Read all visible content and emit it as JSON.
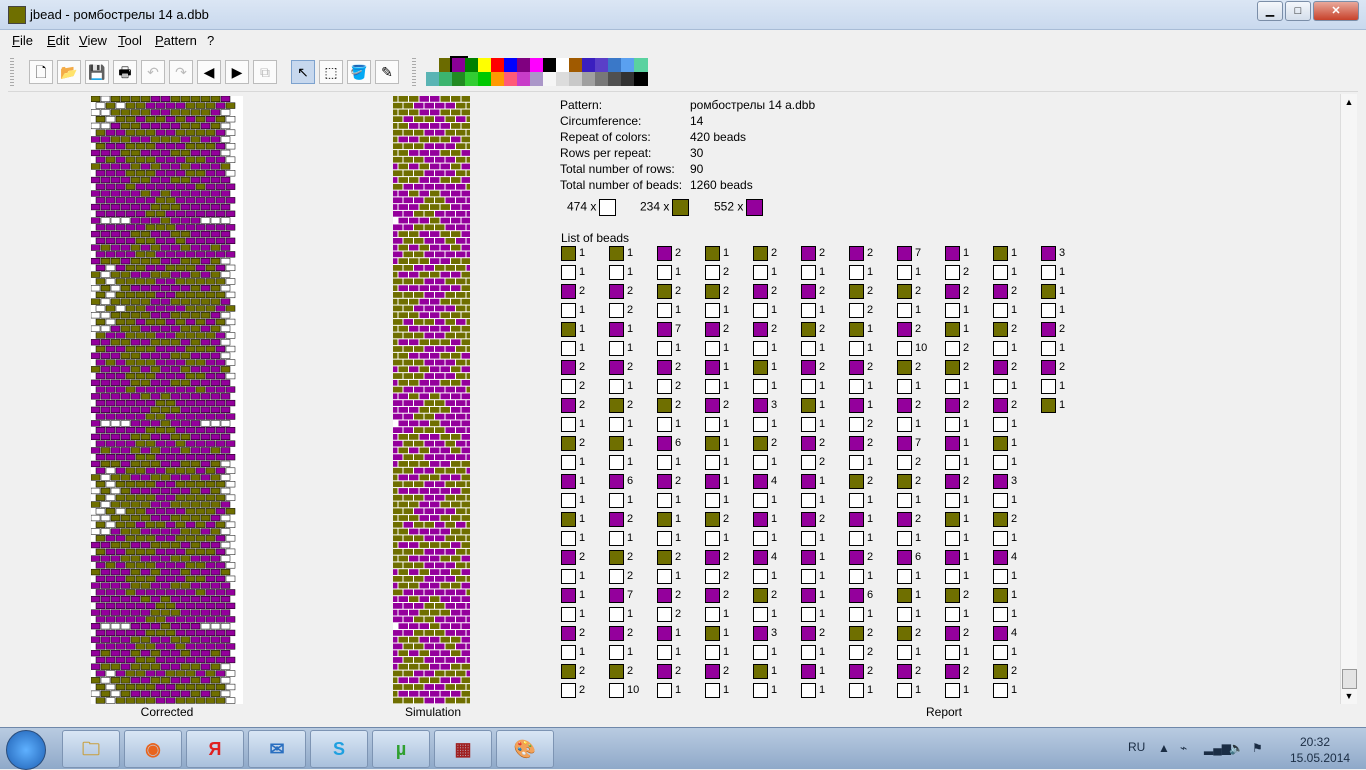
{
  "window": {
    "title": "jbead - ромбострелы 14 a.dbb"
  },
  "window_buttons": {
    "minimize": "▁",
    "maximize": "□",
    "close": "✕"
  },
  "menu": [
    "File",
    "Edit",
    "View",
    "Tool",
    "Pattern",
    "?"
  ],
  "toolbar": {
    "icons": [
      "new-file-icon",
      "open-folder-icon",
      "save-icon",
      "print-icon",
      "undo-icon",
      "redo-icon",
      "arrow-left-icon",
      "arrow-right-icon",
      "copy-icon",
      "pointer-icon",
      "select-rect-icon",
      "fill-bucket-icon",
      "eyedropper-icon"
    ],
    "glyphs": [
      "🗋",
      "📂",
      "💾",
      "🖶",
      "↶",
      "↷",
      "◀",
      "▶",
      "⧉",
      "↖",
      "⬚",
      "🪣",
      "✎"
    ]
  },
  "palette": {
    "row1": [
      "#f0f0f0",
      "#6b6b00",
      "#8a0096",
      "#008000",
      "#ffff00",
      "#ff0000",
      "#0000ff",
      "#800080",
      "#ff00ff",
      "#000000",
      "#ffffff",
      "#a05a00",
      "#3a1fbf",
      "#5a3fc8",
      "#3a78c8",
      "#5aa0f0",
      "#5ad2a0"
    ],
    "row2": [
      "#5ab4b4",
      "#3cb46e",
      "#228b22",
      "#32cd32",
      "#00c800",
      "#ff9a00",
      "#ff5a78",
      "#c83cc8",
      "#aa96c8",
      "#f5f5f5",
      "#dcdcdc",
      "#c8c8c8",
      "#a0a0a0",
      "#787878",
      "#505050",
      "#323232",
      "#000000"
    ],
    "selected_index": 2
  },
  "bead_colors": {
    "0": "#ffffff",
    "1": "#6f6f00",
    "2": "#94009c"
  },
  "panels": {
    "corrected": "Corrected",
    "simulation": "Simulation",
    "report": "Report"
  },
  "info": [
    {
      "key": "Pattern:",
      "value": "ромбострелы 14 a.dbb"
    },
    {
      "key": "Circumference:",
      "value": "14"
    },
    {
      "key": "Repeat of colors:",
      "value": "420 beads"
    },
    {
      "key": "Rows per repeat:",
      "value": "30"
    },
    {
      "key": "Total number of rows:",
      "value": "90"
    },
    {
      "key": "Total number of beads:",
      "value": "1260 beads"
    }
  ],
  "counts": [
    {
      "count": "474 x",
      "color": "#ffffff"
    },
    {
      "count": "234 x",
      "color": "#6f6f00"
    },
    {
      "count": "552 x",
      "color": "#94009c"
    }
  ],
  "list_title": "List of beads",
  "bead_list_columns": [
    [
      [
        1,
        1
      ],
      [
        0,
        1
      ],
      [
        2,
        2
      ],
      [
        0,
        1
      ],
      [
        1,
        1
      ],
      [
        0,
        1
      ],
      [
        2,
        2
      ],
      [
        0,
        2
      ],
      [
        2,
        2
      ],
      [
        0,
        1
      ],
      [
        1,
        2
      ],
      [
        0,
        1
      ],
      [
        2,
        1
      ],
      [
        0,
        1
      ],
      [
        1,
        1
      ],
      [
        0,
        1
      ],
      [
        2,
        2
      ],
      [
        0,
        1
      ],
      [
        2,
        1
      ],
      [
        0,
        1
      ],
      [
        2,
        2
      ],
      [
        0,
        1
      ],
      [
        1,
        2
      ],
      [
        0,
        2
      ]
    ],
    [
      [
        1,
        1
      ],
      [
        0,
        1
      ],
      [
        2,
        2
      ],
      [
        0,
        2
      ],
      [
        2,
        1
      ],
      [
        0,
        1
      ],
      [
        2,
        2
      ],
      [
        0,
        1
      ],
      [
        1,
        2
      ],
      [
        0,
        1
      ],
      [
        1,
        1
      ],
      [
        0,
        1
      ],
      [
        2,
        6
      ],
      [
        0,
        1
      ],
      [
        2,
        2
      ],
      [
        0,
        1
      ],
      [
        1,
        2
      ],
      [
        0,
        2
      ],
      [
        2,
        7
      ],
      [
        0,
        1
      ],
      [
        2,
        2
      ],
      [
        0,
        1
      ],
      [
        1,
        2
      ],
      [
        0,
        10
      ]
    ],
    [
      [
        2,
        2
      ],
      [
        0,
        1
      ],
      [
        1,
        2
      ],
      [
        0,
        1
      ],
      [
        2,
        7
      ],
      [
        0,
        1
      ],
      [
        2,
        2
      ],
      [
        0,
        2
      ],
      [
        1,
        2
      ],
      [
        0,
        1
      ],
      [
        2,
        6
      ],
      [
        0,
        1
      ],
      [
        2,
        2
      ],
      [
        0,
        1
      ],
      [
        1,
        1
      ],
      [
        0,
        1
      ],
      [
        1,
        2
      ],
      [
        0,
        1
      ],
      [
        2,
        2
      ],
      [
        0,
        2
      ],
      [
        2,
        1
      ],
      [
        0,
        1
      ],
      [
        2,
        2
      ],
      [
        0,
        1
      ]
    ],
    [
      [
        1,
        1
      ],
      [
        0,
        2
      ],
      [
        1,
        2
      ],
      [
        0,
        1
      ],
      [
        2,
        2
      ],
      [
        0,
        1
      ],
      [
        2,
        1
      ],
      [
        0,
        1
      ],
      [
        2,
        2
      ],
      [
        0,
        1
      ],
      [
        1,
        1
      ],
      [
        0,
        1
      ],
      [
        2,
        1
      ],
      [
        0,
        1
      ],
      [
        1,
        2
      ],
      [
        0,
        1
      ],
      [
        2,
        2
      ],
      [
        0,
        2
      ],
      [
        2,
        2
      ],
      [
        0,
        1
      ],
      [
        1,
        1
      ],
      [
        0,
        1
      ],
      [
        2,
        2
      ],
      [
        0,
        1
      ]
    ],
    [
      [
        1,
        2
      ],
      [
        0,
        1
      ],
      [
        2,
        2
      ],
      [
        0,
        1
      ],
      [
        2,
        2
      ],
      [
        0,
        1
      ],
      [
        1,
        1
      ],
      [
        0,
        1
      ],
      [
        2,
        3
      ],
      [
        0,
        1
      ],
      [
        1,
        2
      ],
      [
        0,
        1
      ],
      [
        2,
        4
      ],
      [
        0,
        1
      ],
      [
        2,
        1
      ],
      [
        0,
        1
      ],
      [
        2,
        4
      ],
      [
        0,
        1
      ],
      [
        1,
        2
      ],
      [
        0,
        1
      ],
      [
        2,
        3
      ],
      [
        0,
        1
      ],
      [
        1,
        1
      ],
      [
        0,
        1
      ]
    ],
    [
      [
        2,
        2
      ],
      [
        0,
        1
      ],
      [
        2,
        2
      ],
      [
        0,
        1
      ],
      [
        1,
        2
      ],
      [
        0,
        1
      ],
      [
        2,
        2
      ],
      [
        0,
        1
      ],
      [
        1,
        1
      ],
      [
        0,
        1
      ],
      [
        2,
        2
      ],
      [
        0,
        2
      ],
      [
        2,
        1
      ],
      [
        0,
        1
      ],
      [
        2,
        2
      ],
      [
        0,
        1
      ],
      [
        2,
        1
      ],
      [
        0,
        1
      ],
      [
        2,
        1
      ],
      [
        0,
        1
      ],
      [
        2,
        2
      ],
      [
        0,
        1
      ],
      [
        2,
        1
      ],
      [
        0,
        1
      ]
    ],
    [
      [
        2,
        2
      ],
      [
        0,
        1
      ],
      [
        1,
        2
      ],
      [
        0,
        2
      ],
      [
        1,
        1
      ],
      [
        0,
        1
      ],
      [
        2,
        2
      ],
      [
        0,
        1
      ],
      [
        2,
        1
      ],
      [
        0,
        2
      ],
      [
        2,
        2
      ],
      [
        0,
        1
      ],
      [
        1,
        2
      ],
      [
        0,
        1
      ],
      [
        2,
        1
      ],
      [
        0,
        1
      ],
      [
        2,
        2
      ],
      [
        0,
        1
      ],
      [
        2,
        6
      ],
      [
        0,
        1
      ],
      [
        1,
        2
      ],
      [
        0,
        2
      ],
      [
        2,
        2
      ],
      [
        0,
        1
      ]
    ],
    [
      [
        2,
        7
      ],
      [
        0,
        1
      ],
      [
        1,
        2
      ],
      [
        0,
        1
      ],
      [
        2,
        2
      ],
      [
        0,
        10
      ],
      [
        1,
        2
      ],
      [
        0,
        1
      ],
      [
        2,
        2
      ],
      [
        0,
        1
      ],
      [
        2,
        7
      ],
      [
        0,
        2
      ],
      [
        1,
        2
      ],
      [
        0,
        1
      ],
      [
        2,
        2
      ],
      [
        0,
        1
      ],
      [
        2,
        6
      ],
      [
        0,
        1
      ],
      [
        1,
        1
      ],
      [
        0,
        1
      ],
      [
        1,
        2
      ],
      [
        0,
        1
      ],
      [
        2,
        2
      ],
      [
        0,
        1
      ]
    ],
    [
      [
        2,
        1
      ],
      [
        0,
        2
      ],
      [
        2,
        2
      ],
      [
        0,
        1
      ],
      [
        1,
        1
      ],
      [
        0,
        2
      ],
      [
        1,
        2
      ],
      [
        0,
        1
      ],
      [
        2,
        2
      ],
      [
        0,
        1
      ],
      [
        2,
        1
      ],
      [
        0,
        1
      ],
      [
        2,
        2
      ],
      [
        0,
        1
      ],
      [
        1,
        1
      ],
      [
        0,
        1
      ],
      [
        2,
        1
      ],
      [
        0,
        1
      ],
      [
        1,
        2
      ],
      [
        0,
        1
      ],
      [
        2,
        2
      ],
      [
        0,
        1
      ],
      [
        2,
        2
      ],
      [
        0,
        1
      ]
    ],
    [
      [
        1,
        1
      ],
      [
        0,
        1
      ],
      [
        2,
        2
      ],
      [
        0,
        1
      ],
      [
        1,
        2
      ],
      [
        0,
        1
      ],
      [
        2,
        2
      ],
      [
        0,
        1
      ],
      [
        2,
        2
      ],
      [
        0,
        1
      ],
      [
        1,
        1
      ],
      [
        0,
        1
      ],
      [
        2,
        3
      ],
      [
        0,
        1
      ],
      [
        1,
        2
      ],
      [
        0,
        1
      ],
      [
        2,
        4
      ],
      [
        0,
        1
      ],
      [
        1,
        1
      ],
      [
        0,
        1
      ],
      [
        2,
        4
      ],
      [
        0,
        1
      ],
      [
        1,
        2
      ],
      [
        0,
        1
      ]
    ],
    [
      [
        2,
        3
      ],
      [
        0,
        1
      ],
      [
        1,
        1
      ],
      [
        0,
        1
      ],
      [
        2,
        2
      ],
      [
        0,
        1
      ],
      [
        2,
        2
      ],
      [
        0,
        1
      ],
      [
        1,
        1
      ]
    ]
  ],
  "corrected_rows": [
    "10111122111112",
    "01011222211121",
    "00111122111120",
    "10112112121210",
    "00211222211210",
    "12211122111120",
    "22112211121220",
    "12211122211120",
    "22211222112220",
    "21211122211220",
    "12221212212221",
    "22211122211220",
    "22221122112222",
    "22212222221222",
    "22222121222222",
    "22222211222222",
    "22222211122222",
    "22222112222222",
    "20002221222000",
    "22222111222222",
    "22221122112222",
    "22221122122222",
    "21221212212212",
    "22221122222222",
    "21121112211210",
    "20211221112120",
    "10112211221210",
    "10111122111110",
    "01012222221210",
    "10111122111110"
  ],
  "taskbar": {
    "apps": [
      {
        "name": "explorer",
        "glyph": "🗀",
        "color": "#c8a040"
      },
      {
        "name": "firefox",
        "glyph": "◉",
        "color": "#e8641e"
      },
      {
        "name": "yandex",
        "glyph": "Я",
        "color": "#e02020"
      },
      {
        "name": "mail",
        "glyph": "✉",
        "color": "#2a6fc0"
      },
      {
        "name": "skype",
        "glyph": "S",
        "color": "#1fa0e0"
      },
      {
        "name": "utorrent",
        "glyph": "µ",
        "color": "#30a030"
      },
      {
        "name": "jbead",
        "glyph": "▦",
        "color": "#a02020"
      },
      {
        "name": "paint",
        "glyph": "🎨",
        "color": "#5a8ac8"
      }
    ],
    "language": "RU",
    "time": "20:32",
    "date": "15.05.2014"
  }
}
